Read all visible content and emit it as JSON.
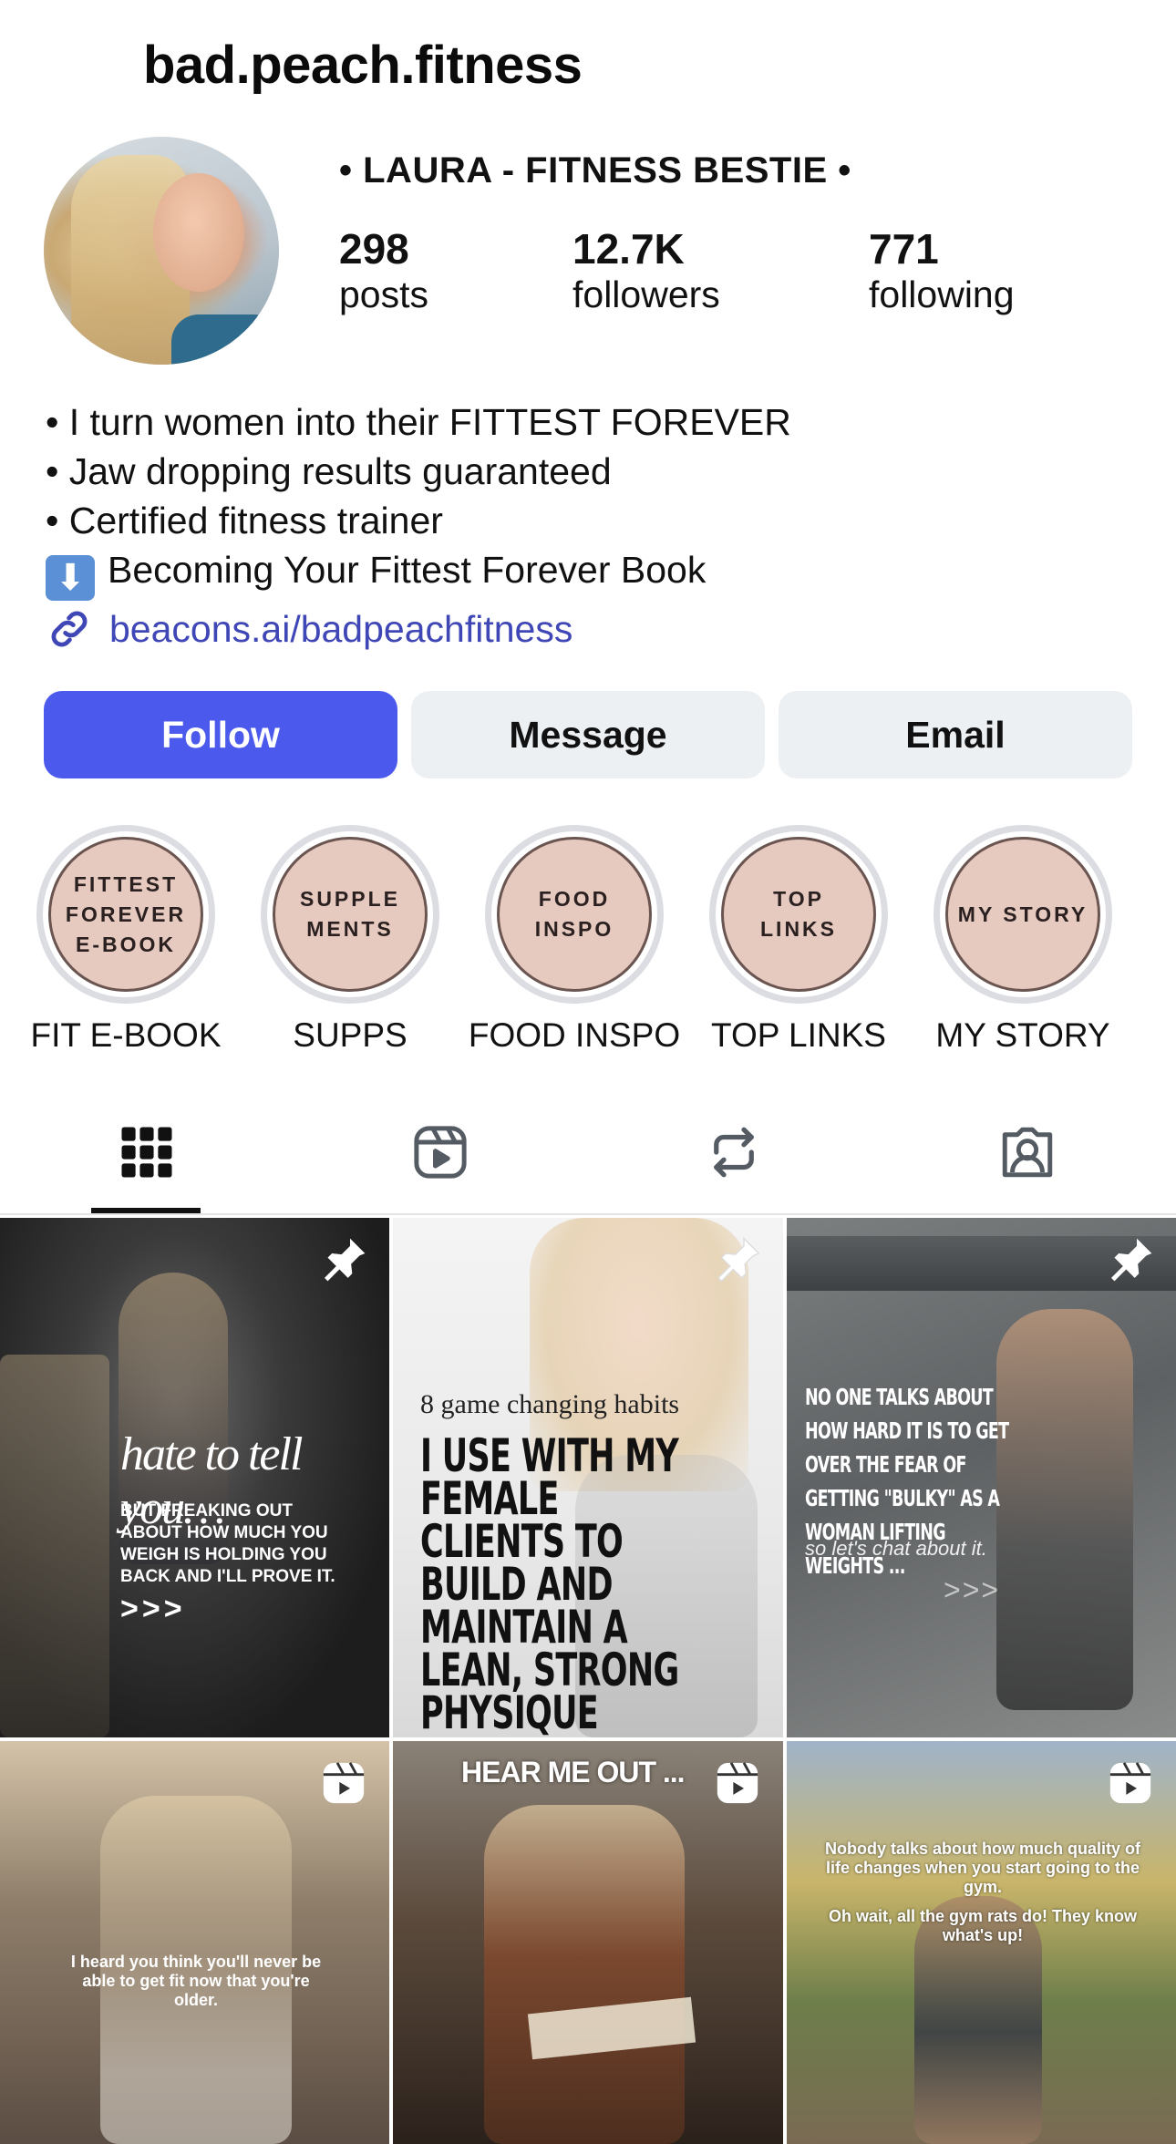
{
  "header": {
    "username": "bad.peach.fitness"
  },
  "profile": {
    "display_name": "• LAURA - FITNESS BESTIE •",
    "stats": [
      {
        "value": "298",
        "label": "posts"
      },
      {
        "value": "12.7K",
        "label": "followers"
      },
      {
        "value": "771",
        "label": "following"
      }
    ],
    "bio": [
      "• I turn women into their FITTEST FOREVER",
      "• Jaw dropping results guaranteed",
      "• Certified fitness trainer",
      "Becoming Your Fittest Forever Book"
    ],
    "bio_emoji": "⬇",
    "link": "beacons.ai/badpeachfitness",
    "link_color": "#3f46b5"
  },
  "actions": {
    "follow": "Follow",
    "message": "Message",
    "email": "Email",
    "follow_color": "#4b5aec"
  },
  "highlights": [
    {
      "cover": "FITTEST FOREVER E-BOOK",
      "label": "FIT E-BOOK"
    },
    {
      "cover": "SUPPLE MENTS",
      "label": "SUPPS"
    },
    {
      "cover": "FOOD INSPO",
      "label": "FOOD INSPO"
    },
    {
      "cover": "TOP LINKS",
      "label": "TOP LINKS"
    },
    {
      "cover": "MY STORY",
      "label": "MY STORY"
    }
  ],
  "tabs": [
    {
      "icon": "grid-icon",
      "active": true
    },
    {
      "icon": "reels-icon",
      "active": false
    },
    {
      "icon": "reposts-icon",
      "active": false
    },
    {
      "icon": "tagged-icon",
      "active": false
    }
  ],
  "posts": [
    {
      "badge": "pin-icon",
      "title": "hate to tell you…",
      "body": "BUT FREAKING OUT ABOUT HOW MUCH YOU WEIGH IS HOLDING YOU BACK AND I'LL PROVE IT.",
      "arrows": ">>>"
    },
    {
      "badge": "pin-icon",
      "kicker": "8 game changing habits",
      "headline": "I USE WITH MY FEMALE CLIENTS TO BUILD AND MAINTAIN A LEAN, STRONG PHYSIQUE"
    },
    {
      "badge": "pin-icon",
      "headline": "NO ONE TALKS ABOUT HOW HARD IT IS TO GET OVER THE FEAR OF GETTING \"BULKY\" AS A WOMAN LIFTING WEIGHTS ...",
      "sub": "so let's chat about it.",
      "arrows": ">>>"
    },
    {
      "badge": "reel-icon",
      "body": "I heard you think you'll never be able to get fit now that you're older."
    },
    {
      "badge": "reel-icon",
      "headline": "HEAR ME OUT ..."
    },
    {
      "badge": "reel-icon",
      "body": "Nobody talks about how much quality of life changes when you start going to the gym.",
      "body2": "Oh wait, all the gym rats do! They know what's up!"
    }
  ]
}
